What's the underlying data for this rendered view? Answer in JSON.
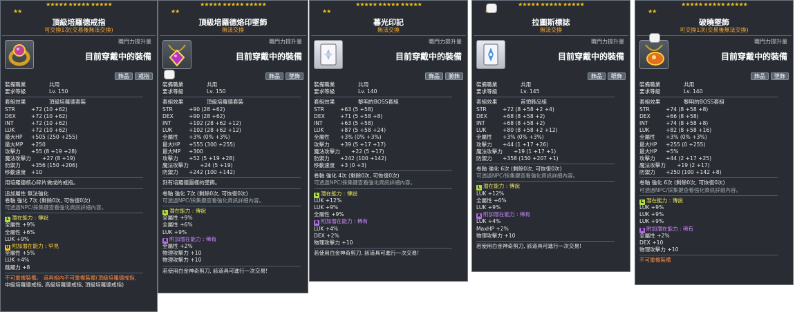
{
  "common": {
    "jp_label": "職門力提升量",
    "wearing_label": "目前穿戴中的裝備",
    "job_label": "裝備職業",
    "job_value": "共用",
    "level_label": "要求等級"
  },
  "tips": [
    {
      "stars_r1": "★★★★★ ★★★★★ ★★★★★",
      "stars_r2": "★★",
      "title": "頂級培羅德戒指",
      "subtitle": "可交換1次(交易後無法交換)",
      "tags": [
        "飾品",
        "戒指"
      ],
      "level": "Lv. 150",
      "set": "頂級培羅德套裝",
      "set_label": "套組效果",
      "stats": [
        {
          "name": "STR",
          "text": "+72 (10 +62)"
        },
        {
          "name": "DEX",
          "text": "+72 (10 +62)"
        },
        {
          "name": "INT",
          "text": "+72 (10 +62)"
        },
        {
          "name": "LUK",
          "text": "+72 (10 +62)"
        },
        {
          "name": "最大HP",
          "text": "+505 (250 +255)"
        },
        {
          "name": "最大MP",
          "text": "+250"
        },
        {
          "name": "攻擊力",
          "text": "+55 (8 +19 +28)"
        },
        {
          "name": "魔法攻擊力",
          "text": "+27 (8 +19)"
        },
        {
          "name": "防禦力",
          "text": "+356 (150 +206)"
        },
        {
          "name": "移動速度",
          "text": "+10"
        }
      ],
      "desc": "用培羅德核心碎片做成的戒指。",
      "extra1": "追加屬性 無法強化",
      "scroll": "卷軸 強化 7次 (剩餘0次, 可恢復0次)",
      "hint": "可透過NPC/採集鍵查看強化資訊詳細內容。",
      "pot_title": "潛在能力 : 傳說",
      "pot": [
        "全屬性 +9%",
        "全屬性 +6%",
        "LUK +9%"
      ],
      "addpot_title": "附加潛在能力 : 罕見",
      "addpot": [
        "全屬性 +5%",
        "LUK +4%",
        "跳躍力 +8"
      ],
      "warn": "不可重複裝備。 道具組內不可重複裝備(頂級培羅德戒指,",
      "warn2": "中級培羅德戒指, 高級培羅德戒指, 頂級培羅德戒指)"
    },
    {
      "stars_r1": "★★★★★ ★★★★★ ★★★★★",
      "stars_r2": "★★",
      "title": "頂級培羅德烙印墜飾",
      "subtitle": "無法交換",
      "tags": [
        "飾品",
        "墜飾"
      ],
      "level": "Lv. 150",
      "set": "頂級培羅德套裝",
      "set_label": "套組效果",
      "stats": [
        {
          "name": "STR",
          "text": "+90 (28 +62)"
        },
        {
          "name": "DEX",
          "text": "+90 (28 +62)"
        },
        {
          "name": "INT",
          "text": "+102 (28 +62 +12)"
        },
        {
          "name": "LUK",
          "text": "+102 (28 +62 +12)"
        },
        {
          "name": "全屬性",
          "text": "+3% (0% +3%)"
        },
        {
          "name": "最大HP",
          "text": "+555 (300 +255)"
        },
        {
          "name": "最大MP",
          "text": "+300"
        },
        {
          "name": "攻擊力",
          "text": "+52 (5 +19 +28)"
        },
        {
          "name": "魔法攻擊力",
          "text": "+24 (5 +19)"
        },
        {
          "name": "防禦力",
          "text": "+242 (100 +142)"
        }
      ],
      "desc": "刻有培羅德圖樣的墜飾。",
      "scroll": "卷軸 強化 7次 (剩餘0次, 可恢復0次)",
      "hint": "可透過NPC/採集鍵查看強化資訊詳細內容。",
      "pot_title": "潛在能力 : 傳說",
      "pot": [
        "全屬性 +9%",
        "全屬性 +6%",
        "LUK +9%"
      ],
      "addpot_title": "附加潛在能力 : 稀有",
      "addpot": [
        "全屬性 +2%",
        "物理攻擊力 +10",
        "物理攻擊力 +10"
      ],
      "footer": "若使用白金神奇剪刀, 該道具可進行一次交易!"
    },
    {
      "stars_r1": "★★★★★ ★★★★★ ★★★★★",
      "stars_r2": "★★",
      "title": "暮光印記",
      "subtitle": "無法交換",
      "tags": [
        "飾品",
        "臉飾"
      ],
      "level": "Lv. 140",
      "set": "黎明的BOSS套組",
      "set_label": "套組效果",
      "stats": [
        {
          "name": "STR",
          "text": "+63 (5 +58)"
        },
        {
          "name": "DEX",
          "text": "+71 (5 +58 +8)"
        },
        {
          "name": "INT",
          "text": "+63 (5 +58)"
        },
        {
          "name": "LUK",
          "text": "+87 (5 +58 +24)"
        },
        {
          "name": "全屬性",
          "text": "+3% (0% +3%)"
        },
        {
          "name": "攻擊力",
          "text": "+39 (5 +17 +17)"
        },
        {
          "name": "魔法攻擊力",
          "text": "+22 (5 +17)"
        },
        {
          "name": "防禦力",
          "text": "+242 (100 +142)"
        },
        {
          "name": "移動速度",
          "text": "+3 (0 +3)"
        }
      ],
      "scroll": "卷軸 強化 4次 (剩餘0次, 可恢復0次)",
      "hint": "可透過NPC/採集鍵查看強化資訊詳細內容。",
      "pot_title": "潛在能力 : 傳說",
      "pot": [
        "LUK +12%",
        "LUK +9%",
        "全屬性 +9%"
      ],
      "addpot_title": "附加潛在能力 : 稀有",
      "addpot": [
        "LUK +4%",
        "DEX +2%",
        "物理攻擊力 +10"
      ],
      "footer": "若使用白金神奇剪刀, 該道具可進行一次交易!"
    },
    {
      "stars_r1": "★★★★★ ★★★★★ ★★★★★",
      "stars_r2": "★★",
      "title": "拉圖斯標誌",
      "subtitle": "無法交換",
      "tags": [
        "飾品",
        "眼飾"
      ],
      "level": "Lv. 145",
      "set": "首領飾品組",
      "set_label": "套組效果",
      "stats": [
        {
          "name": "STR",
          "text": "+72 (8 +58 +2 +4)"
        },
        {
          "name": "DEX",
          "text": "+68 (8 +58 +2)"
        },
        {
          "name": "INT",
          "text": "+68 (8 +58 +2)"
        },
        {
          "name": "LUK",
          "text": "+80 (8 +58 +2 +12)"
        },
        {
          "name": "全屬性",
          "text": "+3% (0% +3%)"
        },
        {
          "name": "攻擊力",
          "text": "+44 (1 +17 +26)"
        },
        {
          "name": "魔法攻擊力",
          "text": "+19 (1 +17 +1)"
        },
        {
          "name": "防禦力",
          "text": "+358 (150 +207 +1)"
        }
      ],
      "scroll": "卷軸 強化 6次 (剩餘0次, 可恢復0次)",
      "hint": "可透過NPC/採集鍵查看強化資訊詳細內容。",
      "pot_title": "潛在能力 : 傳說",
      "pot": [
        "LUK +12%",
        "全屬性 +6%",
        "LUK +9%"
      ],
      "addpot_title": "附加潛在能力 : 稀有",
      "addpot": [
        "LUK +4%",
        "MaxHP +2%",
        "物理攻擊力 +10"
      ],
      "footer": "若使用白金神奇剪刀, 該道具可進行一次交易!"
    },
    {
      "stars_r1": "★★★★★ ★★★★★ ★★★★★",
      "stars_r2": "★★",
      "title": "破曉墜飾",
      "subtitle": "可交換1次(交易後無法交換)",
      "tags": [
        "飾品",
        "墜飾"
      ],
      "level": "Lv. 140",
      "set": "黎明的BOSS套組",
      "set_label": "套組效果",
      "stats": [
        {
          "name": "STR",
          "text": "+74 (8 +58 +8)"
        },
        {
          "name": "DEX",
          "text": "+66 (8 +58)"
        },
        {
          "name": "INT",
          "text": "+74 (8 +58 +8)"
        },
        {
          "name": "LUK",
          "text": "+82 (8 +58 +16)"
        },
        {
          "name": "全屬性",
          "text": "+3% (0% +3%)"
        },
        {
          "name": "最大HP",
          "text": "+255 (0 +255)"
        },
        {
          "name": "最大HP",
          "text": "+5%"
        },
        {
          "name": "攻擊力",
          "text": "+44 (2 +17 +25)"
        },
        {
          "name": "魔法攻擊力",
          "text": "+19 (2 +17)"
        },
        {
          "name": "防禦力",
          "text": "+250 (100 +142 +8)"
        }
      ],
      "scroll": "卷軸 強化 6次 (剩餘0次, 可恢復0次)",
      "hint": "可透過NPC/採集鍵查看強化資訊詳細內容。",
      "pot_title": "潛在能力 : 傳說",
      "pot": [
        "LUK +9%",
        "LUK +9%",
        "LUK +9%"
      ],
      "addpot_title": "附加潛在能力 : 稀有",
      "addpot": [
        "全屬性 +2%",
        "DEX +10",
        "物理攻擊力 +10"
      ],
      "warn": "不可重複裝備"
    }
  ]
}
